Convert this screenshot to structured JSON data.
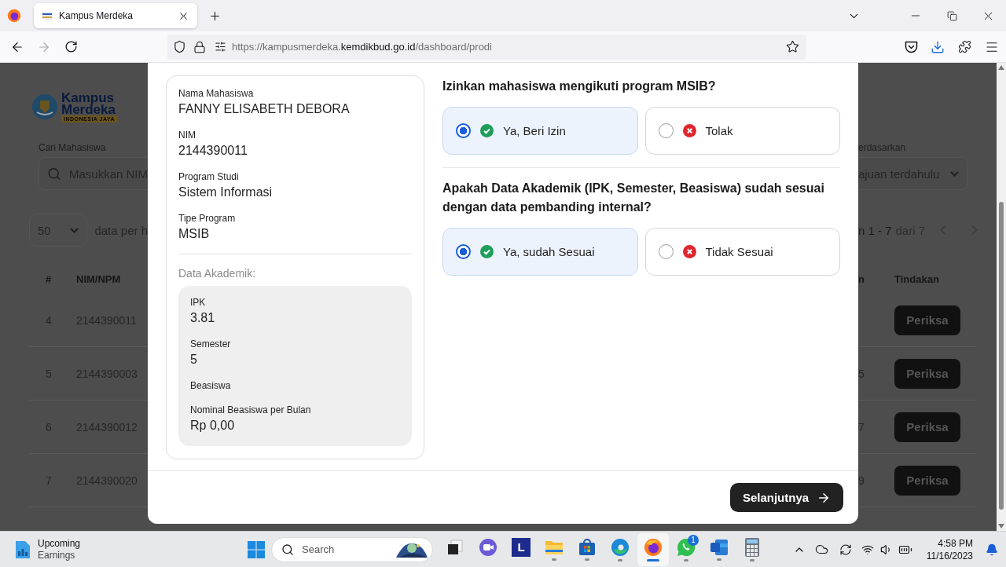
{
  "browser": {
    "tab": {
      "title": "Kampus Merdeka"
    },
    "url_parts": [
      {
        "text": "https://kampusmerdeka.",
        "kind": "dim"
      },
      {
        "text": "kemdikbud.go.id",
        "kind": "host"
      },
      {
        "text": "/dashboard/prodi",
        "kind": "dim"
      }
    ]
  },
  "background_page": {
    "logo": {
      "line_1": "Kampus",
      "line_2": "Merdeka",
      "tagline": "INDONESIA JAYA"
    },
    "search_label": "Cari Mahasiswa",
    "search_placeholder": "Masukkan NIM",
    "page_size": "50",
    "page_size_suffix": "data per h",
    "sort_label": "erdasarkan",
    "sort_value": "ajuan terdahulu",
    "range": "n 1 - 7",
    "range_total": "dari 7",
    "columns": [
      "#",
      "NIM/NPM",
      "n",
      "Tindakan"
    ],
    "rows": [
      {
        "number": "4",
        "nim": "2144390011",
        "action": "Periksa"
      },
      {
        "number": "5",
        "nim": "2144390003",
        "column_3": "5",
        "action": "Periksa"
      },
      {
        "number": "6",
        "nim": "2144390012",
        "column_3": "7",
        "action": "Periksa"
      },
      {
        "number": "7",
        "nim": "2144390020",
        "column_3": "9",
        "action": "Periksa"
      }
    ]
  },
  "modal": {
    "student_fields": [
      {
        "label": "Nama Mahasiswa",
        "value": "FANNY ELISABETH DEBORA"
      },
      {
        "label": "NIM",
        "value": "2144390011"
      },
      {
        "label": "Program Studi",
        "value": "Sistem Informasi"
      },
      {
        "label": "Tipe Program",
        "value": "MSIB"
      }
    ],
    "academic_title": "Data Akademik:",
    "academic_fields": [
      {
        "label": "IPK",
        "value": "3.81"
      },
      {
        "label": "Semester",
        "value": "5"
      },
      {
        "label": "Beasiswa"
      },
      {
        "label": "Nominal Beasiswa per Bulan",
        "value": "Rp 0,00"
      }
    ],
    "questions": [
      {
        "text": "Izinkan mahasiswa mengikuti program MSIB?",
        "options": [
          {
            "label": "Ya, Beri Izin",
            "kind": "approve",
            "selected": true
          },
          {
            "label": "Tolak",
            "kind": "reject",
            "selected": false
          }
        ]
      },
      {
        "text": "Apakah Data Akademik (IPK, Semester, Beasiswa) sudah sesuai dengan data pembanding internal?",
        "options": [
          {
            "label": "Ya, sudah Sesuai",
            "kind": "approve",
            "selected": true
          },
          {
            "label": "Tidak Sesuai",
            "kind": "reject",
            "selected": false
          }
        ]
      }
    ],
    "next_button": "Selanjutnya"
  },
  "taskbar": {
    "widget": {
      "line_1": "Upcoming",
      "line_2": "Earnings"
    },
    "search_placeholder": "Search",
    "apps": [
      {
        "kind": "taskview",
        "running": false,
        "selected": false
      },
      {
        "kind": "meet",
        "running": false,
        "selected": false
      },
      {
        "kind": "letter",
        "letter": "L",
        "running": false,
        "selected": false
      },
      {
        "kind": "folder",
        "running": true,
        "selected": false
      },
      {
        "kind": "store",
        "running": true,
        "selected": false
      },
      {
        "kind": "edge",
        "running": true,
        "selected": false
      },
      {
        "kind": "firefox",
        "running": true,
        "selected": true
      },
      {
        "kind": "whatsapp",
        "running": true,
        "selected": false,
        "badge": "1"
      },
      {
        "kind": "word",
        "running": true,
        "selected": false
      },
      {
        "kind": "calculator",
        "running": true,
        "selected": false
      }
    ],
    "time": "4:58 PM",
    "date": "11/16/2023"
  }
}
